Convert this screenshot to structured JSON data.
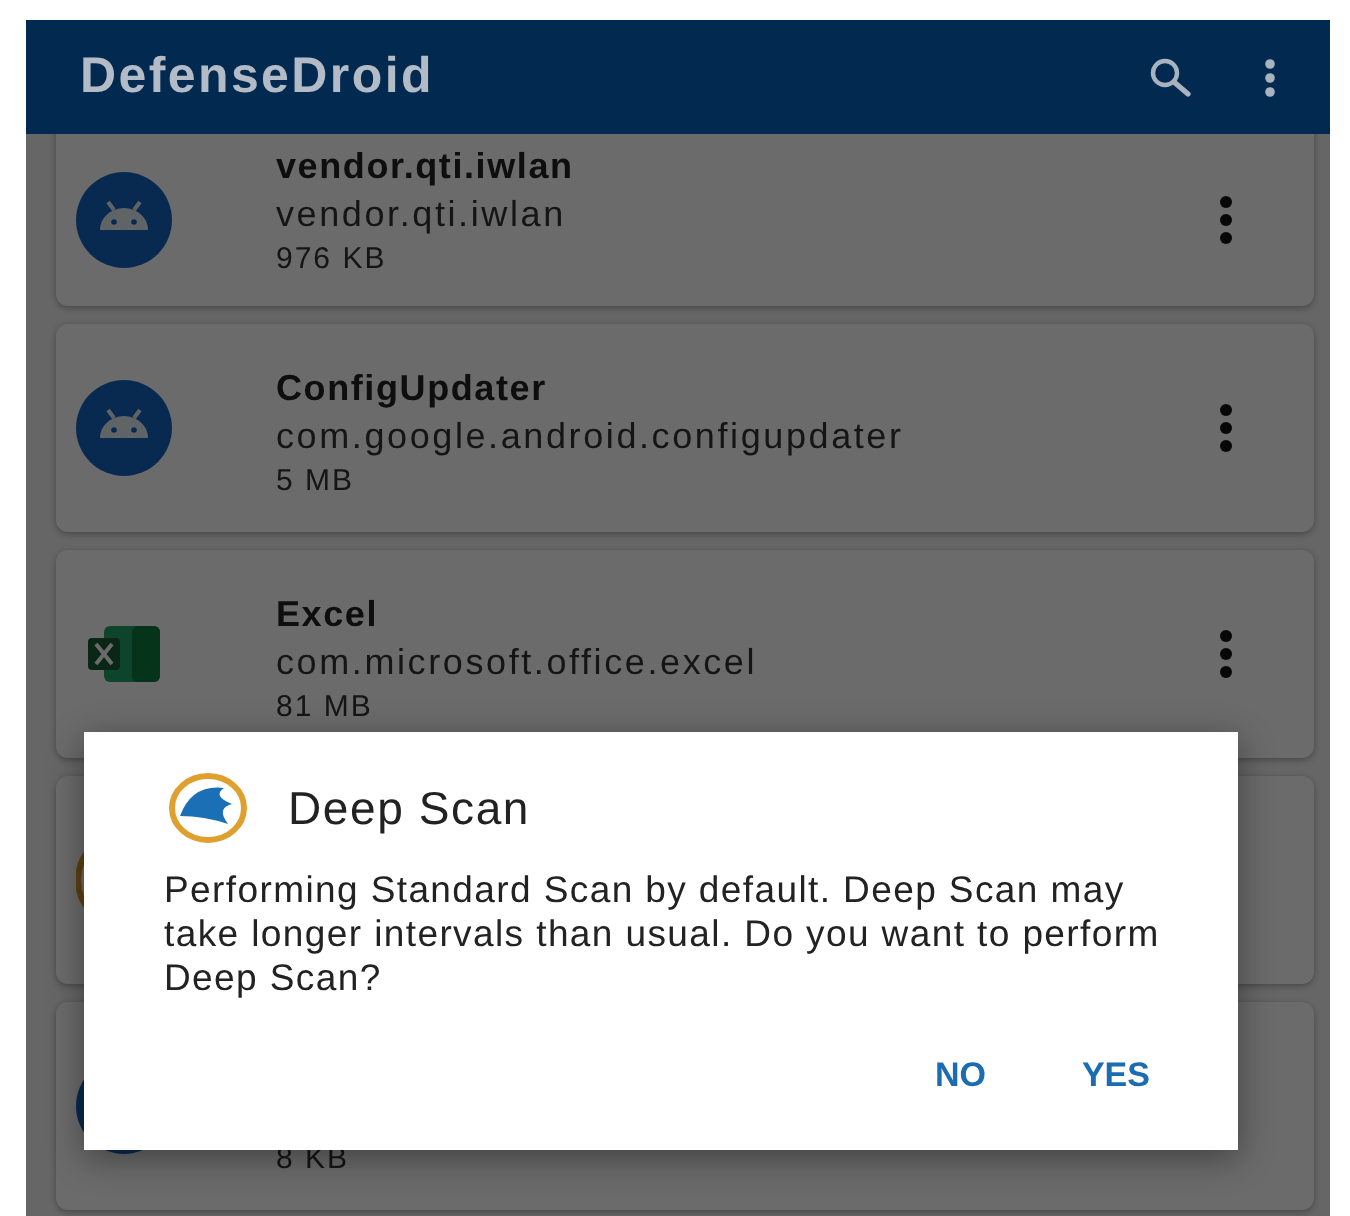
{
  "app_bar": {
    "title": "DefenseDroid"
  },
  "apps": [
    {
      "kind": "android",
      "name": "vendor.qti.iwlan",
      "package": "vendor.qti.iwlan",
      "size": "976 KB"
    },
    {
      "kind": "android",
      "name": "ConfigUpdater",
      "package": "com.google.android.configupdater",
      "size": "5 MB"
    },
    {
      "kind": "excel",
      "name": "Excel",
      "package": "com.microsoft.office.excel",
      "size": "81 MB"
    },
    {
      "kind": "shield"
    },
    {
      "kind": "android",
      "size": "8 KB"
    }
  ],
  "dialog": {
    "title": "Deep Scan",
    "message": "Performing Standard Scan by default. Deep Scan may take longer intervals than usual. Do you want to perform Deep Scan?",
    "buttons": [
      "NO",
      "YES"
    ]
  }
}
